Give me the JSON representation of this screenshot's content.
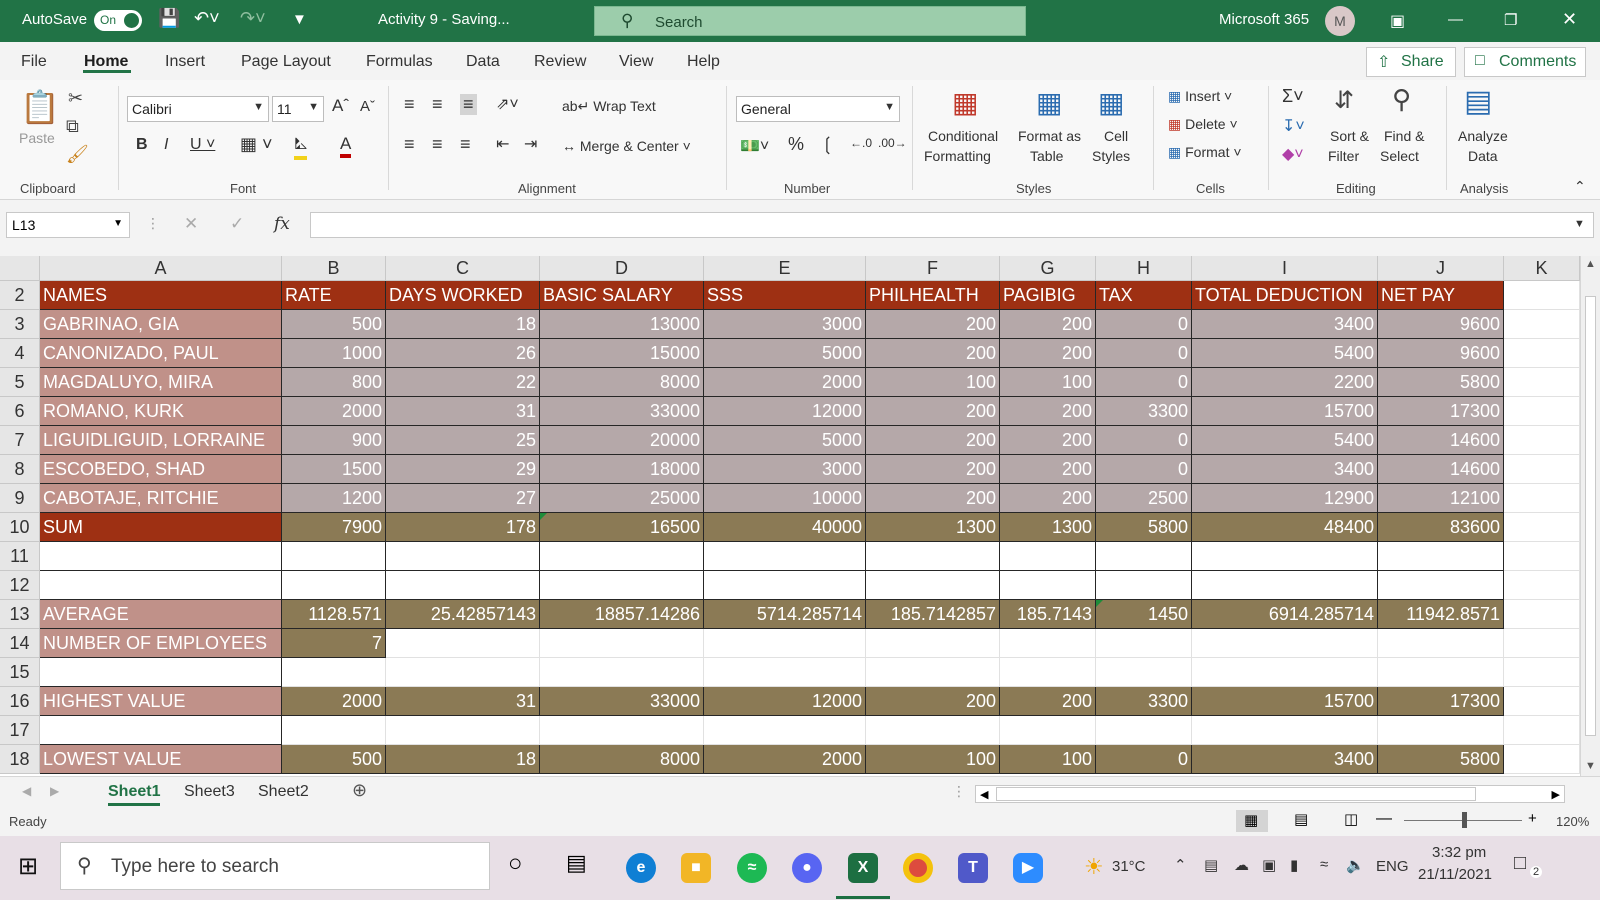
{
  "titlebar": {
    "autosave_label": "AutoSave",
    "autosave_state": "On",
    "doc_title": "Activity 9 - Saving...",
    "search_placeholder": "Search",
    "account": "Microsoft 365",
    "avatar_initial": "M"
  },
  "tabs": [
    "File",
    "Home",
    "Insert",
    "Page Layout",
    "Formulas",
    "Data",
    "Review",
    "View",
    "Help"
  ],
  "share_label": "Share",
  "comments_label": "Comments",
  "ribbon": {
    "clipboard": {
      "paste": "Paste",
      "label": "Clipboard"
    },
    "font": {
      "family": "Calibri",
      "size": "11",
      "label": "Font"
    },
    "alignment": {
      "wrap": "Wrap Text",
      "merge": "Merge & Center",
      "label": "Alignment"
    },
    "number": {
      "format": "General",
      "label": "Number"
    },
    "styles": {
      "cond1": "Conditional",
      "cond2": "Formatting",
      "fmt1": "Format as",
      "fmt2": "Table",
      "cell1": "Cell",
      "cell2": "Styles",
      "label": "Styles"
    },
    "cells": {
      "insert": "Insert",
      "delete": "Delete",
      "format": "Format",
      "label": "Cells"
    },
    "editing": {
      "sort1": "Sort &",
      "sort2": "Filter",
      "find1": "Find &",
      "find2": "Select",
      "label": "Editing"
    },
    "analysis": {
      "a1": "Analyze",
      "a2": "Data",
      "label": "Analysis"
    }
  },
  "formula_bar": {
    "name_box": "L13",
    "fx": "fx",
    "value": ""
  },
  "columns": [
    "A",
    "B",
    "C",
    "D",
    "E",
    "F",
    "G",
    "H",
    "I",
    "J",
    "K"
  ],
  "rows": [
    {
      "n": "2",
      "style": "hdr",
      "cells": [
        "NAMES",
        "RATE",
        "DAYS WORKED",
        "BASIC SALARY",
        "SSS",
        "PHILHEALTH",
        "PAGIBIG",
        "TAX",
        "TOTAL DEDUCTION",
        "NET PAY"
      ]
    },
    {
      "n": "3",
      "style": "emp",
      "cells": [
        "GABRINAO, GIA",
        "500",
        "18",
        "13000",
        "3000",
        "200",
        "200",
        "0",
        "3400",
        "9600"
      ]
    },
    {
      "n": "4",
      "style": "emp",
      "cells": [
        "CANONIZADO, PAUL",
        "1000",
        "26",
        "15000",
        "5000",
        "200",
        "200",
        "0",
        "5400",
        "9600"
      ]
    },
    {
      "n": "5",
      "style": "emp",
      "cells": [
        "MAGDALUYO, MIRA",
        "800",
        "22",
        "8000",
        "2000",
        "100",
        "100",
        "0",
        "2200",
        "5800"
      ]
    },
    {
      "n": "6",
      "style": "emp",
      "cells": [
        "ROMANO, KURK",
        "2000",
        "31",
        "33000",
        "12000",
        "200",
        "200",
        "3300",
        "15700",
        "17300"
      ]
    },
    {
      "n": "7",
      "style": "emp",
      "cells": [
        "LIGUIDLIGUID, LORRAINE",
        "900",
        "25",
        "20000",
        "5000",
        "200",
        "200",
        "0",
        "5400",
        "14600"
      ]
    },
    {
      "n": "8",
      "style": "emp",
      "cells": [
        "ESCOBEDO, SHAD",
        "1500",
        "29",
        "18000",
        "3000",
        "200",
        "200",
        "0",
        "3400",
        "14600"
      ]
    },
    {
      "n": "9",
      "style": "emp",
      "cells": [
        "CABOTAJE, RITCHIE",
        "1200",
        "27",
        "25000",
        "10000",
        "200",
        "200",
        "2500",
        "12900",
        "12100"
      ]
    },
    {
      "n": "10",
      "style": "sum",
      "cells": [
        "SUM",
        "7900",
        "178",
        "16500",
        "40000",
        "1300",
        "1300",
        "5800",
        "48400",
        "83600"
      ]
    },
    {
      "n": "11",
      "style": "blankb",
      "cells": [
        "",
        "",
        "",
        "",
        "",
        "",
        "",
        "",
        "",
        ""
      ]
    },
    {
      "n": "12",
      "style": "blankb",
      "cells": [
        "",
        "",
        "",
        "",
        "",
        "",
        "",
        "",
        "",
        ""
      ]
    },
    {
      "n": "13",
      "style": "stat",
      "cells": [
        "AVERAGE",
        "1128.571",
        "25.42857143",
        "18857.14286",
        "5714.285714",
        "185.7142857",
        "185.7143",
        "1450",
        "6914.285714",
        "11942.8571"
      ]
    },
    {
      "n": "14",
      "style": "count",
      "cells": [
        "NUMBER OF EMPLOYEES",
        "7",
        "",
        "",
        "",
        "",
        "",
        "",
        "",
        ""
      ]
    },
    {
      "n": "15",
      "style": "blank",
      "cells": [
        "",
        "",
        "",
        "",
        "",
        "",
        "",
        "",
        "",
        ""
      ]
    },
    {
      "n": "16",
      "style": "stat",
      "cells": [
        "HIGHEST VALUE",
        "2000",
        "31",
        "33000",
        "12000",
        "200",
        "200",
        "3300",
        "15700",
        "17300"
      ]
    },
    {
      "n": "17",
      "style": "blank",
      "cells": [
        "",
        "",
        "",
        "",
        "",
        "",
        "",
        "",
        "",
        ""
      ]
    },
    {
      "n": "18",
      "style": "stat",
      "cells": [
        "LOWEST VALUE",
        "500",
        "18",
        "8000",
        "2000",
        "100",
        "100",
        "0",
        "3400",
        "5800"
      ]
    }
  ],
  "sheets": [
    "Sheet1",
    "Sheet3",
    "Sheet2"
  ],
  "status": {
    "ready": "Ready",
    "zoom": "120%"
  },
  "taskbar": {
    "search_placeholder": "Type here to search",
    "temperature": "31°C",
    "lang": "ENG",
    "time": "3:32 pm",
    "date": "21/11/2021",
    "notif_count": "2"
  },
  "colors": {
    "header_red": "#9e3013",
    "name_pink": "#c09189",
    "value_gray": "#b5a8a9",
    "sum_olive": "#8b7a55",
    "excel_green": "#217346"
  }
}
